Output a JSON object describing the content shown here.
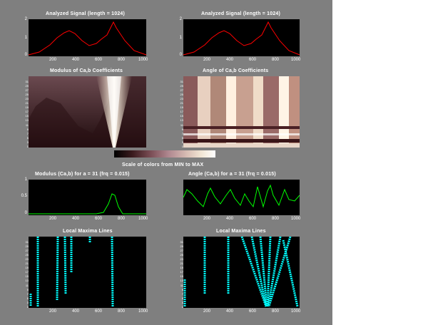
{
  "titles": {
    "signal_left": "Analyzed Signal (length = 1024)",
    "signal_right": "Analyzed Signal (length = 1024)",
    "modulus": "Modulus of Ca,b Coefficients",
    "angle": "Angle of Ca,b Coefficients",
    "colorbar": "Scale of colors from MIN to MAX",
    "modulus_slice": "Modulus (Ca,b)   for a = 31  (frq = 0.015)",
    "angle_slice": "Angle (Ca,b)   for a = 31  (frq = 0.015)",
    "maxima_left": "Local Maxima Lines",
    "maxima_right": "Local Maxima Lines"
  },
  "ticks": {
    "x": [
      "200",
      "400",
      "600",
      "800",
      "1000"
    ],
    "y_signal": [
      "0",
      "1",
      "2"
    ],
    "y_modulus_slice": [
      "0",
      "0.5",
      "1"
    ],
    "y_scales": [
      "1",
      "3",
      "5",
      "7",
      "9",
      "11",
      "13",
      "15",
      "17",
      "19",
      "21",
      "23",
      "25",
      "27",
      "29",
      "31"
    ]
  },
  "colors": {
    "panel_bg": "#7f7f7f",
    "axes_bg": "#000000",
    "signal_line": "#ff0000",
    "slice_line": "#00ff00",
    "maxima_line": "#00ffff"
  }
}
